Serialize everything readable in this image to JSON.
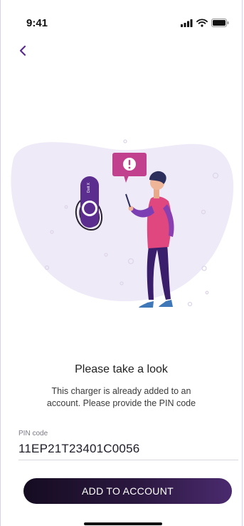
{
  "status_bar": {
    "time": "9:41"
  },
  "illustration": {
    "device_label": "Dott X"
  },
  "content": {
    "title": "Please take a look",
    "description": "This charger is already added to an account. Please provide the PIN code"
  },
  "pin_field": {
    "label": "PIN code",
    "value": "11EP21T23401C0056"
  },
  "actions": {
    "add_label": "ADD TO ACCOUNT"
  },
  "colors": {
    "accent_purple": "#5b2d8e",
    "alert_pink": "#c2418e",
    "blob": "#efeaf7"
  }
}
